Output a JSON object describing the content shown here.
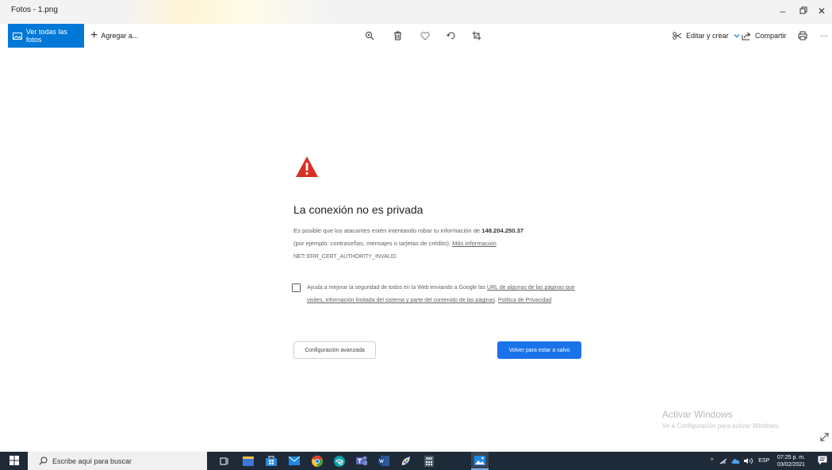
{
  "window": {
    "title": "Fotos - 1.png"
  },
  "toolbar": {
    "all_photos": "Ver todas las fotos",
    "add_to": "Agregar a...",
    "edit_create": "Editar y crear",
    "share": "Compartir"
  },
  "error": {
    "title": "La conexión no es privada",
    "p1": "Es posible que los atacantes estén intentando robar tu información de",
    "host": "148.204.250.37",
    "p2": "(por ejemplo: contraseñas, mensajes o tarjetas de crédito).",
    "more_info": "Más información",
    "code": "NET::ERR_CERT_AUTHORITY_INVALID",
    "check_text": "Ayuda a mejorar la seguridad de todos en la Web enviando a Google las",
    "check_link": "URL de algunas de las páginas que visites, información limitada del sistema y parte del contenido de las páginas",
    "privacy_link": "Política de Privacidad",
    "advanced_button": "Configuración avanzada",
    "safe_button": "Volver para estar a salvo"
  },
  "watermark": {
    "line1": "Activar Windows",
    "line2": "Ve a Configuración para activar Windows."
  },
  "taskbar": {
    "search_placeholder": "Escribe aquí para buscar",
    "language": "ESP",
    "time": "07:25 p. m.",
    "date": "03/02/2021"
  },
  "colors": {
    "accent": "#0078d7",
    "warning_red": "#d93025",
    "button_blue": "#1a73e8",
    "taskbar": "#1f2a38"
  }
}
